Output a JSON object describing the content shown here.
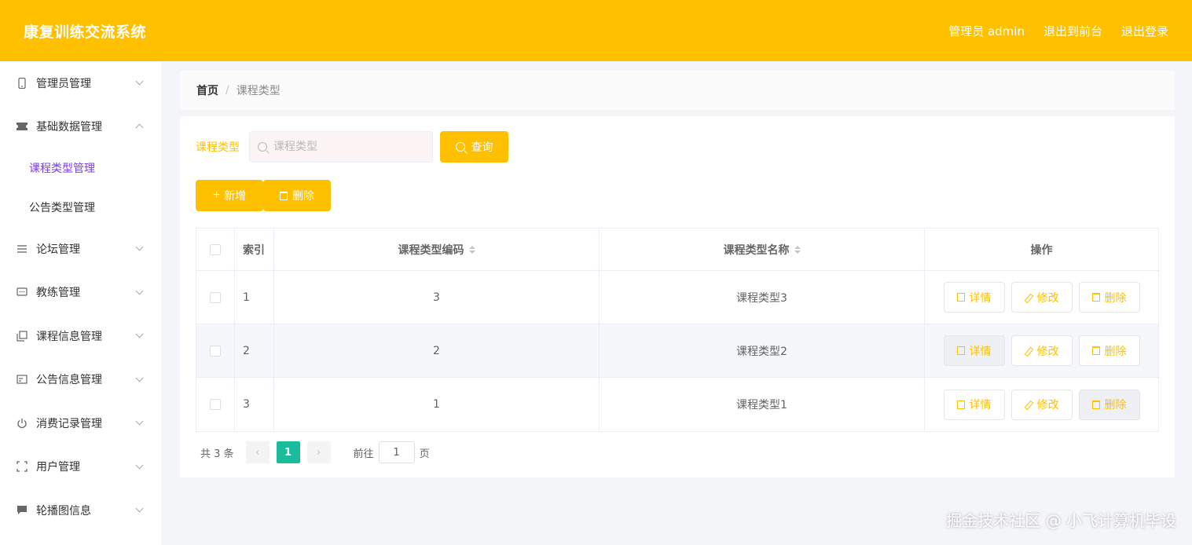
{
  "header": {
    "title": "康复训练交流系统",
    "admin_label": "管理员 admin",
    "frontend_link": "退出到前台",
    "logout_link": "退出登录"
  },
  "sidebar": {
    "items": [
      {
        "label": "管理员管理",
        "icon": "phone-icon"
      },
      {
        "label": "基础数据管理",
        "icon": "ticket-icon",
        "expanded": true
      },
      {
        "label": "课程类型管理",
        "sub": true,
        "active": true
      },
      {
        "label": "公告类型管理",
        "sub": true
      },
      {
        "label": "论坛管理",
        "icon": "list-icon"
      },
      {
        "label": "教练管理",
        "icon": "chat-icon"
      },
      {
        "label": "课程信息管理",
        "icon": "copy-icon"
      },
      {
        "label": "公告信息管理",
        "icon": "card-icon"
      },
      {
        "label": "消费记录管理",
        "icon": "power-icon"
      },
      {
        "label": "用户管理",
        "icon": "fullscreen-icon"
      },
      {
        "label": "轮播图信息",
        "icon": "message-icon"
      }
    ]
  },
  "breadcrumb": {
    "home": "首页",
    "separator": "/",
    "current": "课程类型"
  },
  "filter": {
    "label": "课程类型",
    "placeholder": "课程类型",
    "query_button": "查询"
  },
  "actions": {
    "add_button": "新增",
    "delete_button": "删除"
  },
  "table": {
    "headers": {
      "index": "索引",
      "code": "课程类型编码",
      "name": "课程类型名称",
      "ops": "操作"
    },
    "rows": [
      {
        "index": "1",
        "code": "3",
        "name": "课程类型3"
      },
      {
        "index": "2",
        "code": "2",
        "name": "课程类型2"
      },
      {
        "index": "3",
        "code": "1",
        "name": "课程类型1"
      }
    ],
    "op_labels": {
      "detail": "详情",
      "edit": "修改",
      "delete": "删除"
    }
  },
  "pagination": {
    "total_text": "共 3 条",
    "current_page": "1",
    "goto_label": "前往",
    "goto_value": "1",
    "page_suffix": "页"
  },
  "watermark": "掘金技术社区 @ 小飞计算机毕设",
  "colors": {
    "accent": "#ffc000",
    "active_menu": "#7b3fe4",
    "page_active": "#1abc9c"
  }
}
